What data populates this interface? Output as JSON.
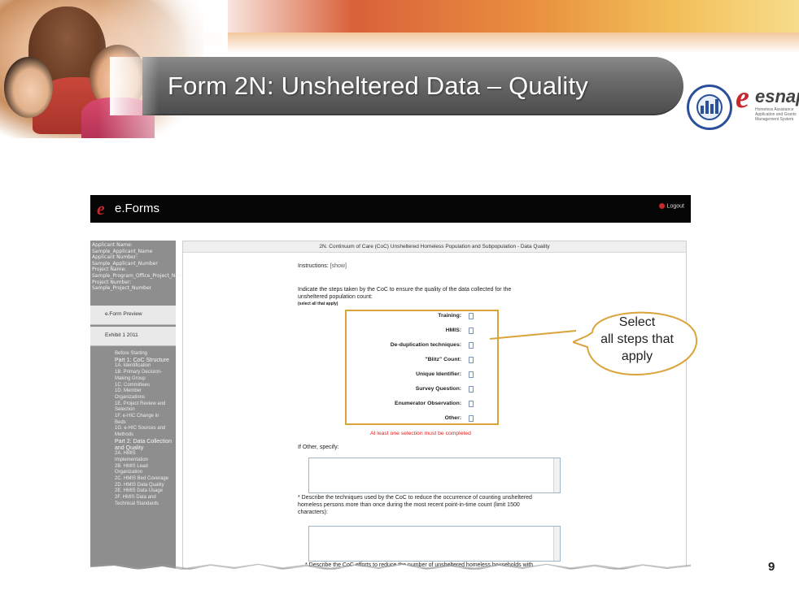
{
  "slide": {
    "title": "Form 2N: Unsheltered Data – Quality",
    "page_number": "9",
    "logo": "esnaps",
    "logo_subtitle": "Homeless Assistance Application and Grants Management System"
  },
  "callout": {
    "line1": "Select",
    "line2": "all steps that",
    "line3": "apply",
    "color": "#d9a43a"
  },
  "app": {
    "brand": "e.Forms",
    "logout": "Logout"
  },
  "sidebar": {
    "info": [
      "Applicant Name:",
      "Sample_Applicant_Name",
      "Applicant Number:",
      "Sample_Applicant_Number",
      "Project Name:",
      "Sample_Program_Office_Project_Name",
      "Project Number:",
      "Sample_Project_Number"
    ],
    "tabs": [
      "e.Form Preview",
      "Exhibit 1 2011"
    ],
    "nav": [
      "Before Starting",
      "Part 1: CoC Structure",
      "1A. Identification",
      "1B. Primary Decision-",
      "Making Group",
      "1C. Committees",
      "1D. Member",
      "Organizations",
      "1E. Project Review and",
      "Selection",
      "1F. e-HIC Change in",
      "Beds",
      "1G. e-HIC Sources and",
      "Methods",
      "Part 2: Data Collection",
      "and Quality",
      "2A. HMIS",
      "Implementation",
      "2B. HMIS Lead",
      "Organization",
      "2C. HMIS Bed Coverage",
      "2D. HMIS Data Quality",
      "2E. HMIS Data Usage",
      "2F. HMIS Data and",
      "Technical Standards"
    ]
  },
  "form": {
    "header": "2N. Continuum of Care (CoC) Unsheltered Homeless Population and Subpopulation - Data Quality",
    "instructions_label": "Instructions:",
    "instructions_link": "[show]",
    "question": "Indicate the steps taken by the CoC to ensure the quality of the data collected for the unsheltered population count:",
    "select_note": "(select all that apply)",
    "options": [
      {
        "label": "Training:",
        "checked": false
      },
      {
        "label": "HMIS:",
        "checked": false
      },
      {
        "label": "De-duplication techniques:",
        "checked": false
      },
      {
        "label": "\"Blitz\" Count:",
        "checked": false
      },
      {
        "label": "Unique Identifier:",
        "checked": false
      },
      {
        "label": "Survey Question:",
        "checked": false
      },
      {
        "label": "Enumerator Observation:",
        "checked": false
      },
      {
        "label": "Other:",
        "checked": false
      }
    ],
    "required_message": "At least one selection must be completed",
    "other_label": "If Other, specify:",
    "other_value": "",
    "question2": "* Describe the techniques used by the CoC to reduce the occurrence of counting unsheltered homeless persons more than once during the most recent point-in-time count (limit 1500 characters):",
    "question2_value": "",
    "question3": "* Describe the CoC efforts to reduce the number of unsheltered homeless households with"
  }
}
